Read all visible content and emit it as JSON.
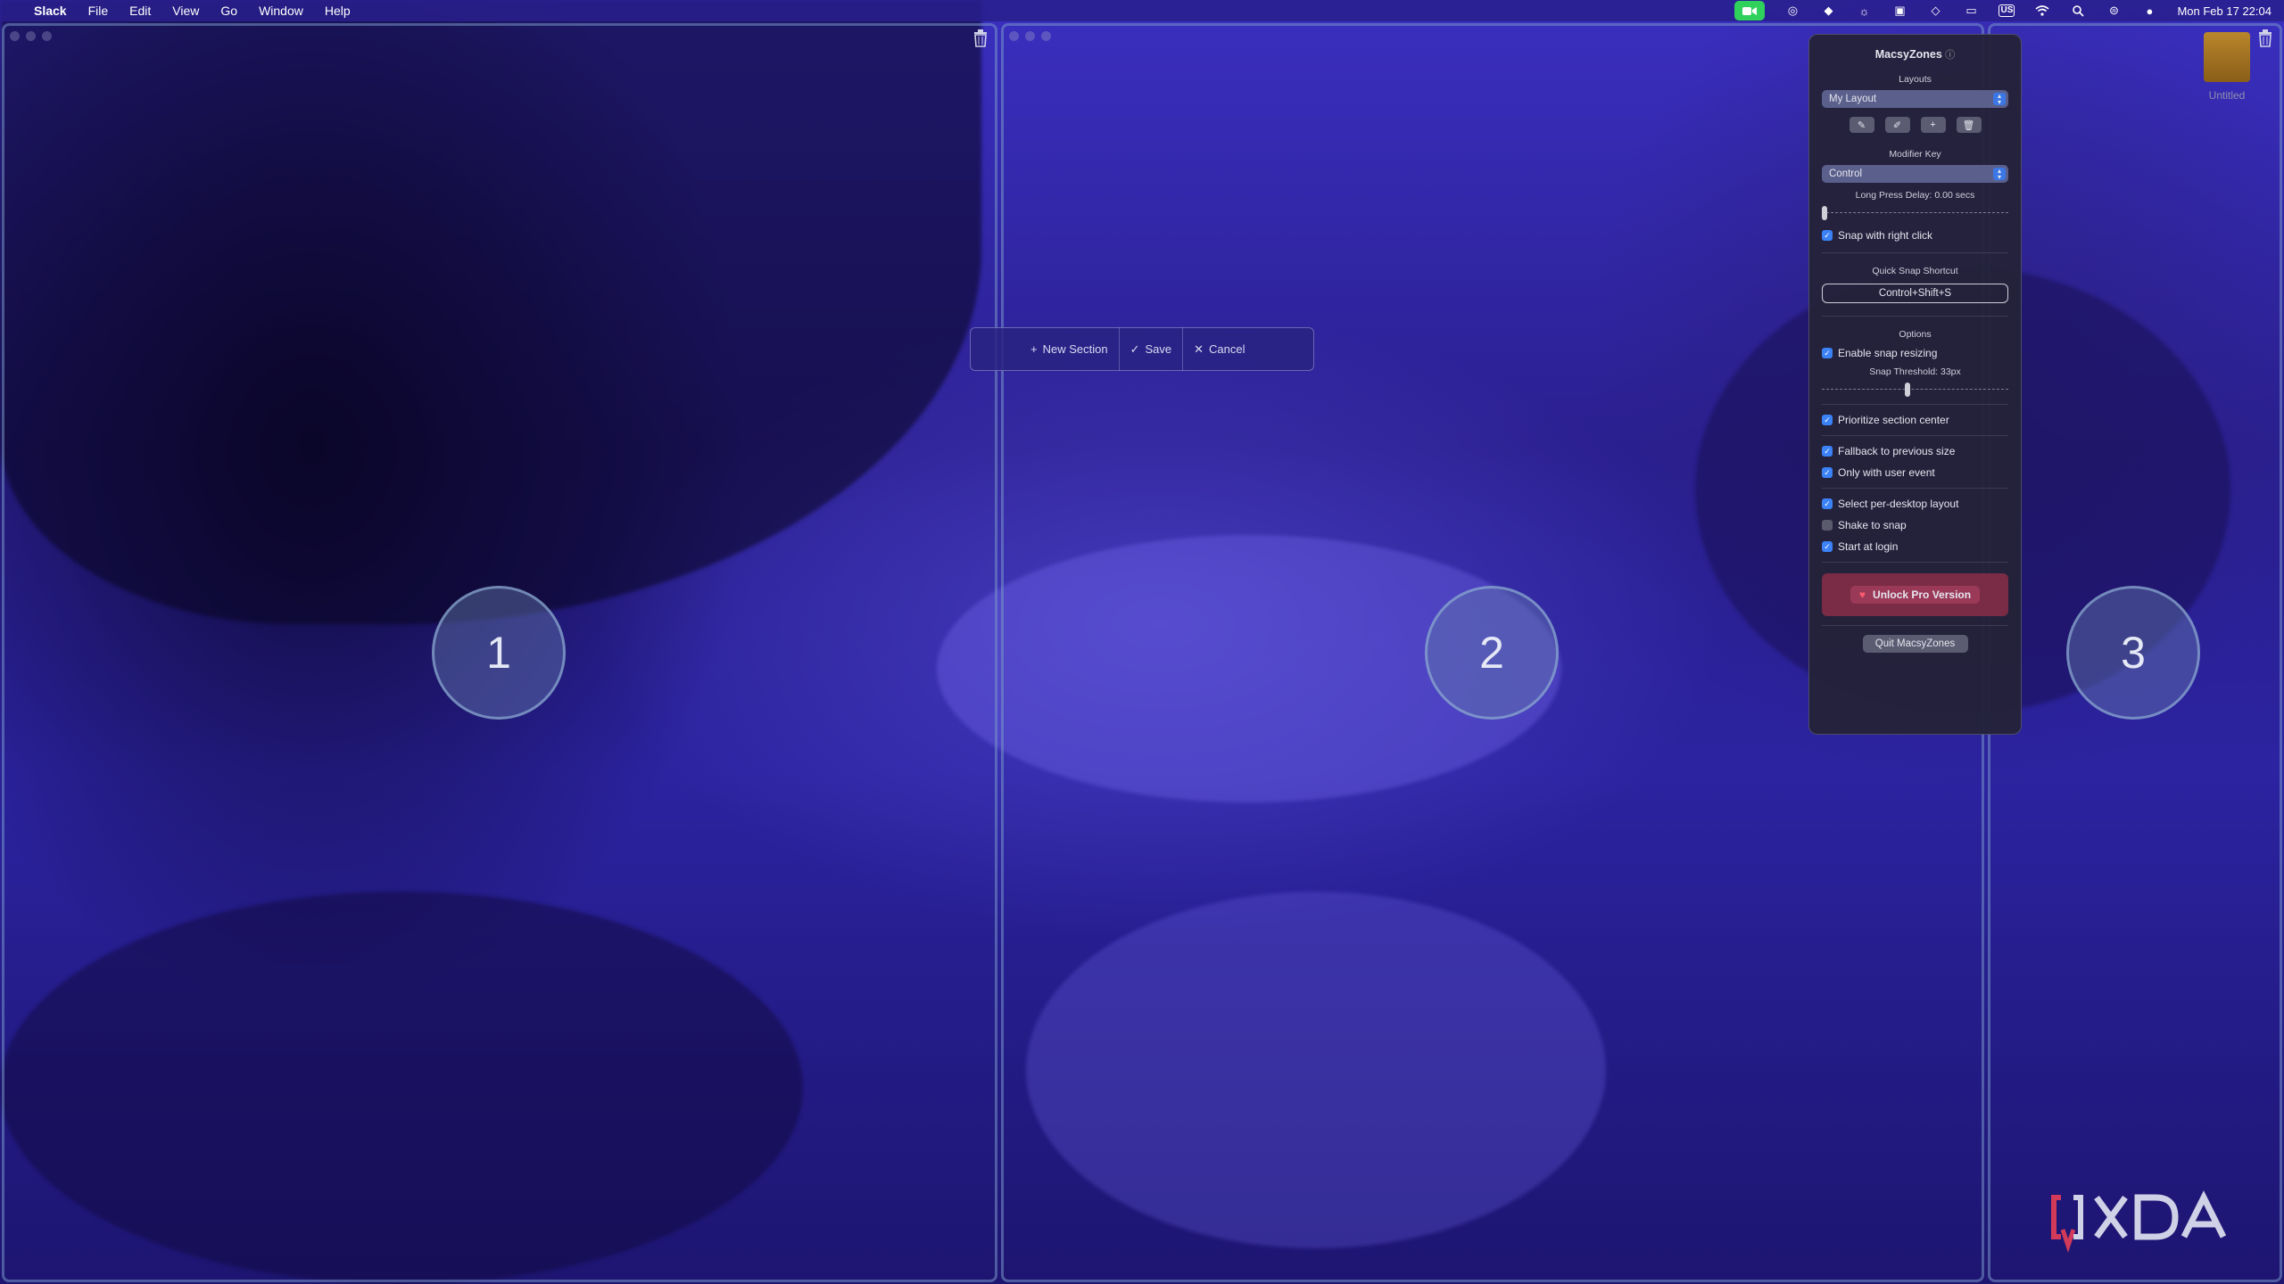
{
  "menubar": {
    "app": "Slack",
    "menus": [
      "File",
      "Edit",
      "View",
      "Go",
      "Window",
      "Help"
    ],
    "clock": "Mon Feb 17  22:04",
    "keyboard": "US"
  },
  "zones": [
    {
      "number": "1"
    },
    {
      "number": "2"
    },
    {
      "number": "3"
    }
  ],
  "toolbar": {
    "new_section": "New Section",
    "save": "Save",
    "cancel": "Cancel"
  },
  "popover": {
    "title": "MacsyZones",
    "layouts_heading": "Layouts",
    "layout_selected": "My Layout",
    "modifier_heading": "Modifier Key",
    "modifier_selected": "Control",
    "long_press_label": "Long Press Delay: 0.00 secs",
    "long_press_value": 0,
    "snap_right_click": "Snap with right click",
    "quick_snap_heading": "Quick Snap Shortcut",
    "quick_snap_value": "Control+Shift+S",
    "options_heading": "Options",
    "enable_snap_resizing": "Enable snap resizing",
    "snap_threshold_label": "Snap Threshold: 33px",
    "snap_threshold_fraction": 0.45,
    "prioritize_center": "Prioritize section center",
    "fallback_size": "Fallback to previous size",
    "only_user_event": "Only with user event",
    "per_desktop": "Select per-desktop layout",
    "shake_to_snap": "Shake to snap",
    "start_login": "Start at login",
    "unlock_pro": "Unlock Pro Version",
    "quit": "Quit MacsyZones"
  },
  "desktop_item": {
    "label": "Untitled"
  },
  "watermark": "XDA"
}
